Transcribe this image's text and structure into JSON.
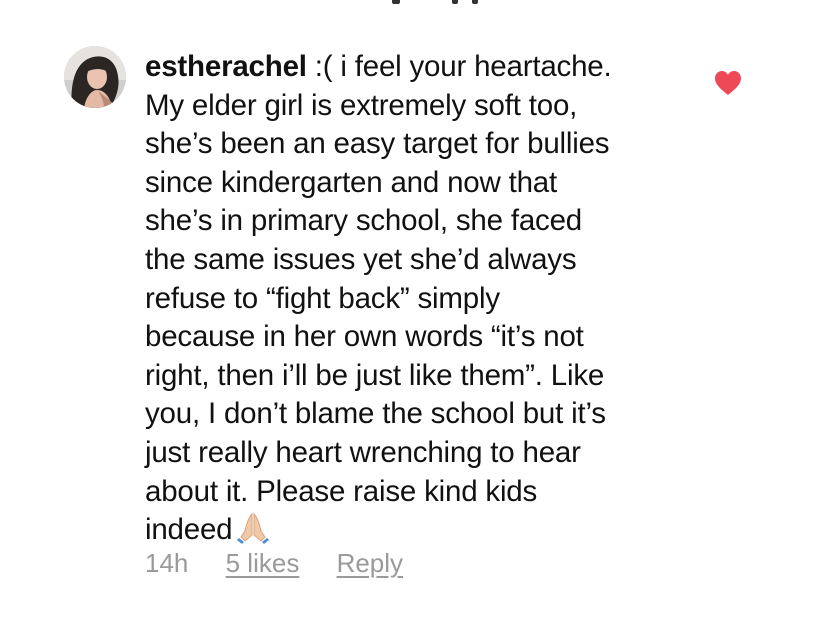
{
  "comment": {
    "username": "estherachel",
    "lines": [
      " :( i feel your heartache.",
      "My elder girl is extremely soft too,",
      "she’s been an easy target for bullies",
      "since kindergarten and now that",
      "she’s in primary school, she faced",
      "the same issues yet she’d always",
      "refuse to “fight back” simply",
      "because in her own words “it’s not",
      "right, then i’ll be just like them”. Like",
      "you, I don’t blame the school but it’s",
      "just really heart wrenching to hear",
      "about it. Please raise kind kids",
      "indeed"
    ],
    "trailing_emoji": "folded-hands-emoji",
    "time_ago": "14h",
    "likes_label": "5 likes",
    "reply_label": "Reply",
    "liked": true
  },
  "colors": {
    "text": "#111111",
    "meta": "#9a9a9a",
    "heart": "#ed4956"
  },
  "icons": {
    "like": "heart-icon",
    "avatar": "avatar"
  }
}
